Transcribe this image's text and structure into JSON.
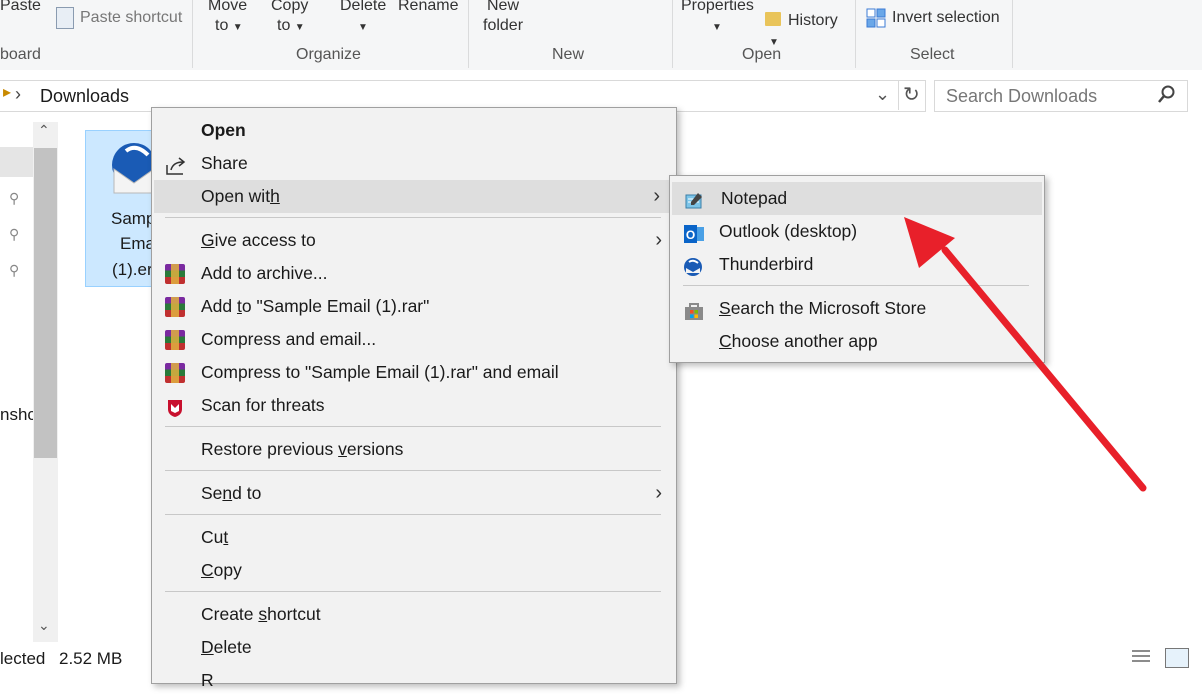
{
  "ribbon": {
    "paste": "Paste",
    "paste_shortcut": "Paste shortcut",
    "move_to_1": "Move",
    "move_to_2": "to",
    "copy_to_1": "Copy",
    "copy_to_2": "to",
    "delete": "Delete",
    "rename": "Rename",
    "new_folder_1": "New",
    "new_folder_2": "folder",
    "properties": "Properties",
    "history": "History",
    "invert_selection": "Invert selection",
    "groups": {
      "clipboard": "board",
      "organize": "Organize",
      "new": "New",
      "open": "Open",
      "select": "Select"
    }
  },
  "address": {
    "path": "Downloads",
    "search_placeholder": "Search Downloads"
  },
  "nav": {
    "partial_label": "nshc"
  },
  "file": {
    "line1": "Samp",
    "line2": "Ema",
    "line3": "(1).er"
  },
  "status": {
    "selected": "lected",
    "size": "2.52 MB"
  },
  "context_menu": {
    "open": "Open",
    "share": "Share",
    "open_with_a": "Open wit",
    "open_with_b": "h",
    "give_access_a": "",
    "give_access_b": "G",
    "give_access_c": "ive access to",
    "add_archive_a": "Add to archive...",
    "add_to_rar_a": "Add ",
    "add_to_rar_b": "t",
    "add_to_rar_c": "o \"Sample Email (1).rar\"",
    "compress_email": "Compress and email...",
    "compress_to_rar_email": "Compress to \"Sample Email (1).rar\" and email",
    "scan": "Scan for threats",
    "restore_a": "Restore previous ",
    "restore_b": "v",
    "restore_c": "ersions",
    "send_to_a": "Se",
    "send_to_b": "n",
    "send_to_c": "d to",
    "cut_a": "Cu",
    "cut_b": "t",
    "copy_a": "",
    "copy_b": "C",
    "copy_c": "opy",
    "create_shortcut_a": "Create ",
    "create_shortcut_b": "s",
    "create_shortcut_c": "hortcut",
    "delete_a": "",
    "delete_b": "D",
    "delete_c": "elete",
    "partial_next": "R"
  },
  "submenu": {
    "notepad": "Notepad",
    "outlook": "Outlook (desktop)",
    "thunderbird": "Thunderbird",
    "store_a": "",
    "store_b": "S",
    "store_c": "earch the Microsoft Store",
    "choose_a": "",
    "choose_b": "C",
    "choose_c": "hoose another app"
  },
  "colors": {
    "accent_arrow": "#e8202a",
    "highlight": "#dedede",
    "selection": "#cce8ff"
  }
}
